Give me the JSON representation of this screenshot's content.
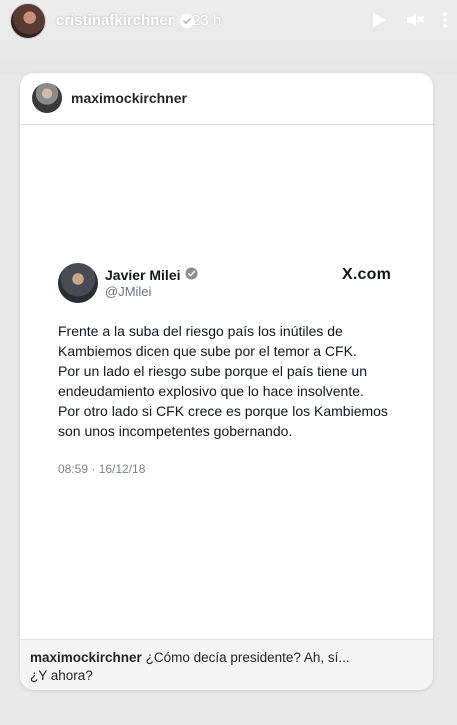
{
  "story": {
    "username": "cristinafkirchner",
    "time": "23 h"
  },
  "post": {
    "username": "maximockirchner",
    "caption_user": "maximockirchner",
    "caption_text_line1": "¿Cómo decía presidente? Ah, sí...",
    "caption_text_line2": "¿Y ahora?"
  },
  "tweet": {
    "name": "Javier Milei",
    "handle": "@JMilei",
    "source": "X.com",
    "lines": [
      "Frente a la suba del riesgo país los inútiles de",
      "Kambiemos dicen que sube por el temor a CFK.",
      "Por un lado el riesgo sube porque el país tiene un",
      "endeudamiento explosivo que lo hace insolvente.",
      "Por otro lado si CFK crece es porque los Kambiemos",
      "son unos incompetentes gobernando."
    ],
    "date": "08:59 · 16/12/18"
  },
  "icons": {
    "verified": "verified-badge-icon",
    "play": "play-icon",
    "mute": "speaker-muted-icon",
    "more": "more-vertical-icon"
  },
  "colors": {
    "background": "#e9e9e9",
    "card": "#ffffff",
    "verified_blue": "#1d9bf0"
  }
}
